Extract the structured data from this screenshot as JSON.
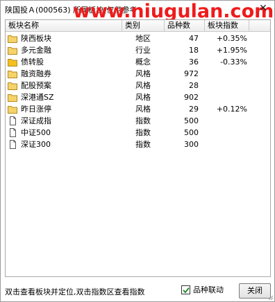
{
  "window": {
    "title": "陕国投Ａ(000563)  所属板块(仅供参考",
    "watermark": "www.niugulan.com"
  },
  "table": {
    "columns": [
      "板块名称",
      "类别",
      "品种数",
      "板块指数"
    ],
    "rows": [
      {
        "icon": "folder-icon",
        "name": "陕西板块",
        "category": "地区",
        "count": "47",
        "index": "+0.35%"
      },
      {
        "icon": "folder-icon",
        "name": "多元金融",
        "category": "行业",
        "count": "18",
        "index": "+1.95%"
      },
      {
        "icon": "folder-filled-icon",
        "name": "债转股",
        "category": "概念",
        "count": "36",
        "index": "-0.33%"
      },
      {
        "icon": "folder-icon",
        "name": "融资融券",
        "category": "风格",
        "count": "972",
        "index": ""
      },
      {
        "icon": "folder-icon",
        "name": "配股预案",
        "category": "风格",
        "count": "28",
        "index": ""
      },
      {
        "icon": "folder-icon",
        "name": "深港通SZ",
        "category": "风格",
        "count": "902",
        "index": ""
      },
      {
        "icon": "folder-icon",
        "name": "昨日涨停",
        "category": "风格",
        "count": "29",
        "index": "+0.12%"
      },
      {
        "icon": "document-icon",
        "name": "深证成指",
        "category": "指数",
        "count": "500",
        "index": ""
      },
      {
        "icon": "document-icon",
        "name": "中证500",
        "category": "指数",
        "count": "500",
        "index": ""
      },
      {
        "icon": "document-icon",
        "name": "深证300",
        "category": "指数",
        "count": "300",
        "index": ""
      }
    ]
  },
  "footer": {
    "hint": "双击查看板块并定位,双击指数区查看指数",
    "linkage_label": "品种联动",
    "linkage_checked": true,
    "close_label": "关闭"
  },
  "colors": {
    "watermark": "#ee1b1b",
    "folder": "#f6d26b",
    "folder_filled": "#f4c020"
  }
}
